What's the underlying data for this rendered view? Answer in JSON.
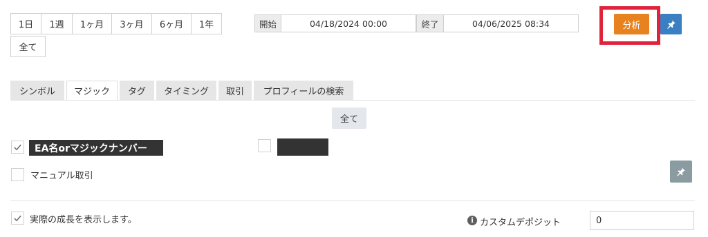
{
  "period_buttons": [
    {
      "label": "1日"
    },
    {
      "label": "1週"
    },
    {
      "label": "1ヶ月"
    },
    {
      "label": "3ヶ月"
    },
    {
      "label": "6ヶ月"
    },
    {
      "label": "1年"
    }
  ],
  "all_period_label": "全て",
  "date_range": {
    "start_label": "開始",
    "start_value": "04/18/2024 00:00",
    "end_label": "終了",
    "end_value": "04/06/2025 08:34"
  },
  "analyze_label": "分析",
  "tabs": [
    {
      "label": "シンボル",
      "active": false
    },
    {
      "label": "マジック",
      "active": true
    },
    {
      "label": "タグ",
      "active": false
    },
    {
      "label": "タイミング",
      "active": false
    },
    {
      "label": "取引",
      "active": false
    },
    {
      "label": "プロフィールの検索",
      "active": false
    }
  ],
  "filter_all_label": "全て",
  "magic_items": {
    "ea_label": "EA名orマジックナンバー",
    "ea_checked": true,
    "second_checked": false,
    "manual_label": "マニュアル取引",
    "manual_checked": false
  },
  "growth_label": "実際の成長を表示します。",
  "growth_checked": true,
  "custom_deposit_label": "カスタムデポジット",
  "custom_deposit_value": "0",
  "colors": {
    "analyze": "#e8821f",
    "highlight": "#e0223a",
    "pin_blue": "#3a7fc1",
    "pin_gray": "#8a9ca1"
  }
}
